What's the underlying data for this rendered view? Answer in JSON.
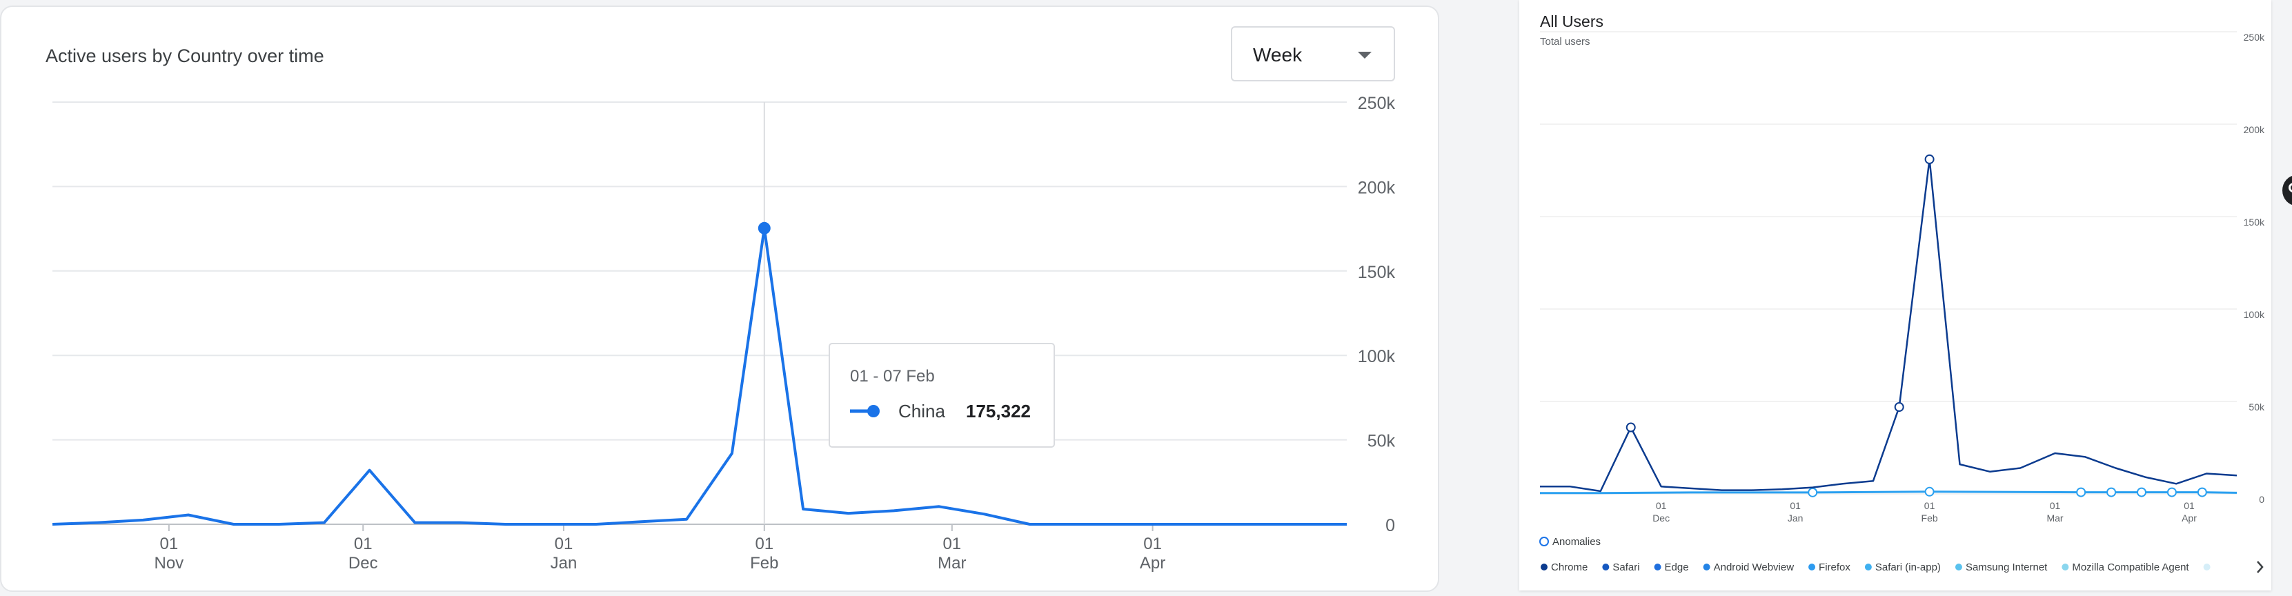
{
  "left_panel": {
    "title": "Active users by Country over time",
    "dropdown": {
      "selected": "Week"
    },
    "tooltip": {
      "date": "01 - 07 Feb",
      "series": "China",
      "value": "175,322"
    }
  },
  "right_panel": {
    "title": "All Users",
    "subtitle": "Total users",
    "anomalies_label": "Anomalies",
    "legend_next_icon": "chevron-right-icon",
    "legend": [
      {
        "name": "Chrome",
        "color": "#0b3b8f"
      },
      {
        "name": "Safari",
        "color": "#1558c0"
      },
      {
        "name": "Edge",
        "color": "#1f6fde"
      },
      {
        "name": "Android Webview",
        "color": "#2484e6"
      },
      {
        "name": "Firefox",
        "color": "#2d9bf0"
      },
      {
        "name": "Safari (in-app)",
        "color": "#3fb0f0"
      },
      {
        "name": "Samsung Internet",
        "color": "#5ac2ee"
      },
      {
        "name": "Mozilla Compatible Agent",
        "color": "#8ad6ee"
      }
    ]
  },
  "chart_data": [
    {
      "type": "line",
      "title": "Active users by Country over time",
      "ylim": [
        0,
        250000
      ],
      "yticks": [
        {
          "v": 0,
          "label": "0"
        },
        {
          "v": 50000,
          "label": "50k"
        },
        {
          "v": 100000,
          "label": "100k"
        },
        {
          "v": 150000,
          "label": "150k"
        },
        {
          "v": 200000,
          "label": "200k"
        },
        {
          "v": 250000,
          "label": "250k"
        }
      ],
      "x_start": "2023-10-14",
      "xticks": [
        {
          "date": "2023-11-01",
          "top": "01",
          "bottom": "Nov"
        },
        {
          "date": "2023-12-01",
          "top": "01",
          "bottom": "Dec"
        },
        {
          "date": "2024-01-01",
          "top": "01",
          "bottom": "Jan"
        },
        {
          "date": "2024-02-01",
          "top": "01",
          "bottom": "Feb"
        },
        {
          "date": "2024-03-01",
          "top": "01",
          "bottom": "Mar"
        },
        {
          "date": "2024-04-01",
          "top": "01",
          "bottom": "Apr"
        }
      ],
      "highlight_index": 16,
      "series": [
        {
          "name": "China",
          "color": "#1a73e8",
          "points": [
            [
              "2023-10-14",
              0
            ],
            [
              "2023-10-21",
              1000
            ],
            [
              "2023-10-28",
              2500
            ],
            [
              "2023-11-04",
              5500
            ],
            [
              "2023-11-11",
              0
            ],
            [
              "2023-11-18",
              0
            ],
            [
              "2023-11-25",
              1000
            ],
            [
              "2023-12-02",
              32000
            ],
            [
              "2023-12-09",
              1000
            ],
            [
              "2023-12-16",
              1000
            ],
            [
              "2023-12-23",
              0
            ],
            [
              "2023-12-30",
              0
            ],
            [
              "2024-01-06",
              0
            ],
            [
              "2024-01-13",
              1500
            ],
            [
              "2024-01-20",
              3000
            ],
            [
              "2024-01-27",
              42000
            ],
            [
              "2024-02-01",
              175322
            ],
            [
              "2024-02-07",
              9000
            ],
            [
              "2024-02-14",
              6500
            ],
            [
              "2024-02-21",
              8000
            ],
            [
              "2024-02-28",
              10500
            ],
            [
              "2024-03-06",
              6000
            ],
            [
              "2024-03-13",
              0
            ],
            [
              "2024-03-20",
              0
            ],
            [
              "2024-03-27",
              0
            ],
            [
              "2024-04-03",
              0
            ],
            [
              "2024-04-10",
              0
            ],
            [
              "2024-04-17",
              0
            ],
            [
              "2024-04-24",
              0
            ],
            [
              "2024-05-01",
              0
            ]
          ]
        }
      ]
    },
    {
      "type": "line",
      "title": "All Users",
      "subtitle": "Total users",
      "ylim": [
        0,
        250000
      ],
      "yticks": [
        {
          "v": 0,
          "label": "0"
        },
        {
          "v": 50000,
          "label": "50k"
        },
        {
          "v": 100000,
          "label": "100k"
        },
        {
          "v": 150000,
          "label": "150k"
        },
        {
          "v": 200000,
          "label": "200k"
        },
        {
          "v": 250000,
          "label": "250k"
        }
      ],
      "x_start": "2023-11-03",
      "xticks": [
        {
          "date": "2023-12-01",
          "top": "01",
          "bottom": "Dec"
        },
        {
          "date": "2024-01-01",
          "top": "01",
          "bottom": "Jan"
        },
        {
          "date": "2024-02-01",
          "top": "01",
          "bottom": "Feb"
        },
        {
          "date": "2024-03-01",
          "top": "01",
          "bottom": "Mar"
        },
        {
          "date": "2024-04-01",
          "top": "01",
          "bottom": "Apr"
        }
      ],
      "series": [
        {
          "name": "Chrome",
          "color": "#0b3b8f",
          "anomalies": [
            "2023-11-24",
            "2024-01-25",
            "2024-02-01"
          ],
          "points": [
            [
              "2023-11-03",
              4000
            ],
            [
              "2023-11-10",
              4000
            ],
            [
              "2023-11-17",
              1500
            ],
            [
              "2023-11-24",
              36000
            ],
            [
              "2023-12-01",
              4000
            ],
            [
              "2023-12-08",
              3000
            ],
            [
              "2023-12-15",
              2000
            ],
            [
              "2023-12-22",
              2000
            ],
            [
              "2023-12-29",
              2500
            ],
            [
              "2024-01-05",
              3500
            ],
            [
              "2024-01-12",
              5500
            ],
            [
              "2024-01-19",
              7000
            ],
            [
              "2024-01-25",
              47000
            ],
            [
              "2024-02-01",
              181000
            ],
            [
              "2024-02-08",
              16000
            ],
            [
              "2024-02-15",
              12000
            ],
            [
              "2024-02-22",
              14000
            ],
            [
              "2024-03-01",
              22000
            ],
            [
              "2024-03-08",
              20000
            ],
            [
              "2024-03-15",
              14000
            ],
            [
              "2024-03-22",
              9000
            ],
            [
              "2024-03-29",
              5500
            ],
            [
              "2024-04-05",
              11000
            ],
            [
              "2024-04-12",
              10000
            ]
          ]
        },
        {
          "name": "Safari",
          "color": "#2aa0f0",
          "anomalies": [
            "2024-01-05",
            "2024-02-01",
            "2024-03-07",
            "2024-03-14",
            "2024-03-21",
            "2024-03-28",
            "2024-04-04"
          ],
          "points": [
            [
              "2023-11-03",
              500
            ],
            [
              "2023-11-17",
              500
            ],
            [
              "2023-12-08",
              800
            ],
            [
              "2024-01-05",
              800
            ],
            [
              "2024-02-01",
              1200
            ],
            [
              "2024-03-07",
              900
            ],
            [
              "2024-03-14",
              900
            ],
            [
              "2024-03-21",
              900
            ],
            [
              "2024-03-28",
              900
            ],
            [
              "2024-04-04",
              900
            ],
            [
              "2024-04-12",
              600
            ]
          ]
        }
      ]
    }
  ]
}
